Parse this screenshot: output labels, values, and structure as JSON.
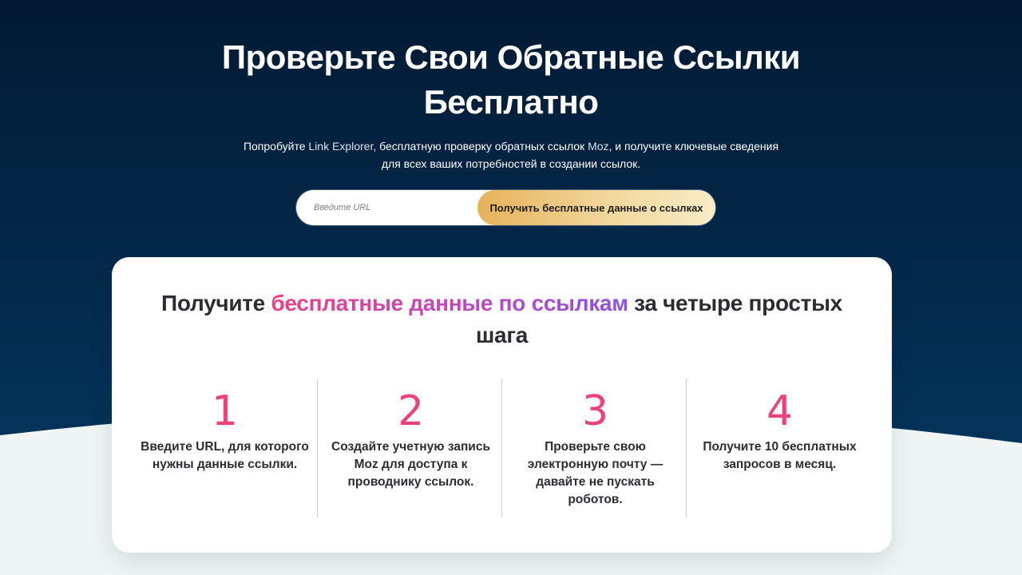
{
  "hero": {
    "title": "Проверьте Свои Обратные Ссылки Бесплатно",
    "subtitle_parts": [
      "Попробуйте ",
      "Link Explorer",
      ", бесплатную проверку обратных ссылок ",
      "Moz",
      ", и получите ключевые сведения для всех ваших потребностей в создании ссылок."
    ]
  },
  "search": {
    "placeholder": "Введите URL",
    "value": "",
    "button_label": "Получить бесплатные данные о ссылках"
  },
  "card": {
    "title_before": "Получите ",
    "title_highlight": "бесплатные данные по ссылкам",
    "title_after": " за четыре простых шага",
    "steps": [
      {
        "number": "1",
        "text": "Введите URL, для которого нужны данные ссылки."
      },
      {
        "number": "2",
        "text": "Создайте учетную запись Moz для доступа к проводнику ссылок."
      },
      {
        "number": "3",
        "text": "Проверьте свою электронную почту — давайте не пускать роботов."
      },
      {
        "number": "4",
        "text": "Получите 10 бесплатных запросов в месяц."
      }
    ]
  },
  "colors": {
    "hero_dark": "#021a33",
    "hero_mid": "#05335a",
    "page_light": "#eef5f4",
    "accent_pink": "#ec4179",
    "accent_purple": "#8a52e0",
    "button_gold": "#e6b25a"
  }
}
